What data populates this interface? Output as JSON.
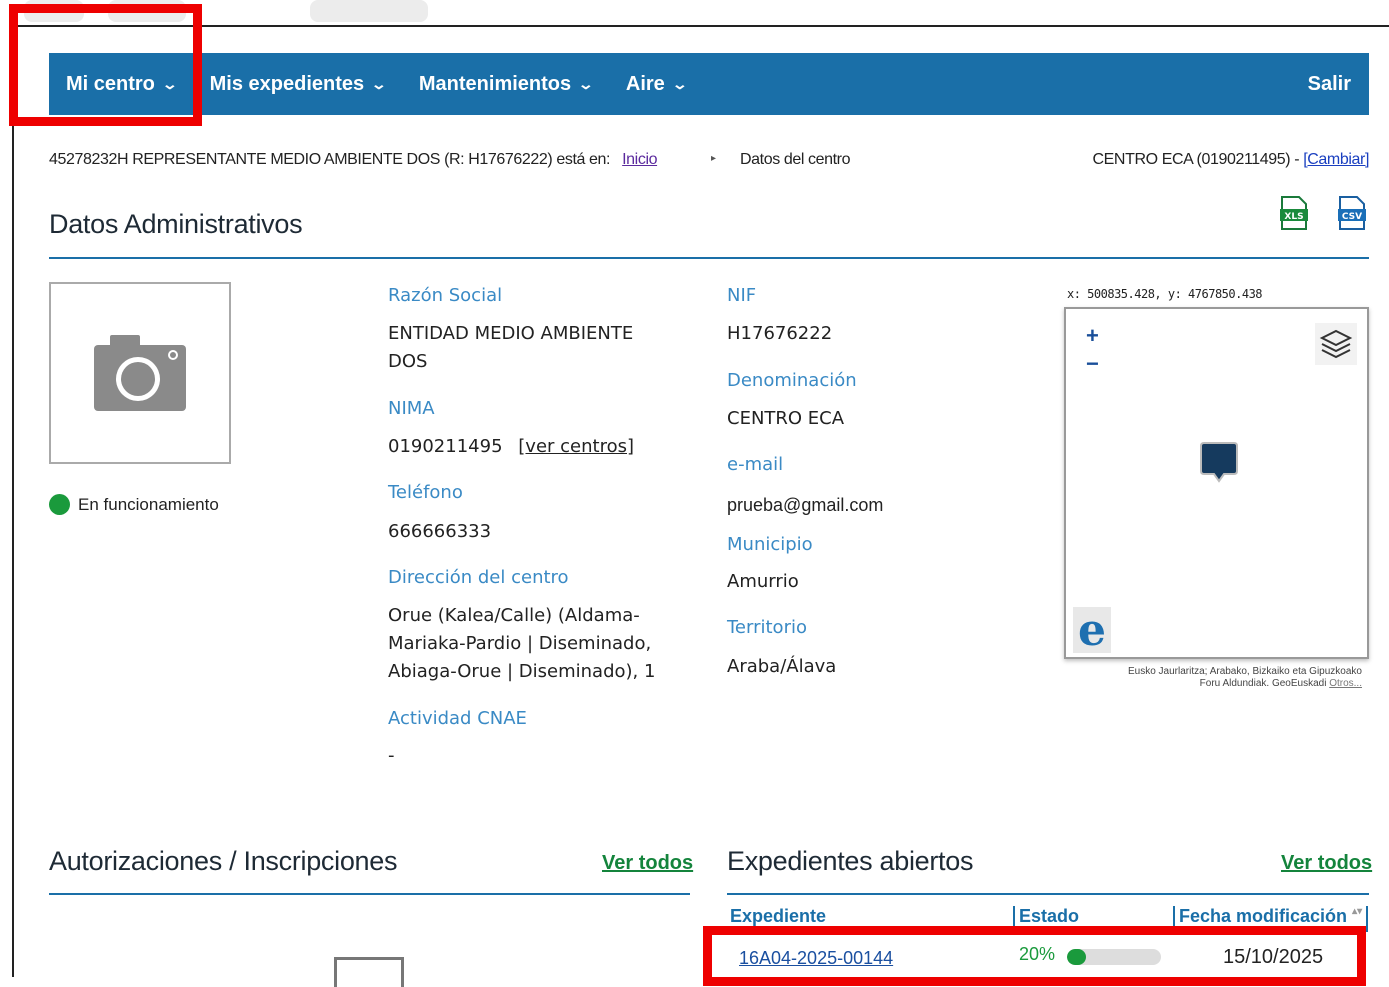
{
  "nav": {
    "items": [
      {
        "label": "Mi centro"
      },
      {
        "label": "Mis expedientes"
      },
      {
        "label": "Mantenimientos"
      },
      {
        "label": "Aire"
      }
    ],
    "exit_label": "Salir"
  },
  "breadcrumb": {
    "user": "45278232H REPRESENTANTE MEDIO AMBIENTE DOS (R: H17676222) está en:",
    "home_label": "Inicio",
    "current": "Datos del centro",
    "center_text": "CENTRO ECA (0190211495) - ",
    "change_label": "[Cambiar]"
  },
  "admin": {
    "title": "Datos Administrativos",
    "status": "En funcionamiento",
    "status_color": "#1a9a3c",
    "razon_social_label": "Razón Social",
    "razon_social_line1": "ENTIDAD MEDIO AMBIENTE",
    "razon_social_line2": "DOS",
    "nima_label": "NIMA",
    "nima_value": "0190211495",
    "ver_centros": "[ver centros]",
    "telefono_label": "Teléfono",
    "telefono_value": "666666333",
    "direccion_label": "Dirección del centro",
    "direccion_line1": "Orue (Kalea/Calle) (Aldama-",
    "direccion_line2": "Mariaka-Pardio | Diseminado,",
    "direccion_line3": "Abiaga-Orue | Diseminado), 1",
    "cnae_label": "Actividad CNAE",
    "cnae_value": "-",
    "nif_label": "NIF",
    "nif_value": "H17676222",
    "denominacion_label": "Denominación",
    "denominacion_value": "CENTRO ECA",
    "email_label": "e-mail",
    "email_value": "prueba@gmail.com",
    "municipio_label": "Municipio",
    "municipio_value": "Amurrio",
    "territorio_label": "Territorio",
    "territorio_value": "Araba/Álava"
  },
  "map": {
    "coords": "x: 500835.428, y: 4767850.438",
    "zoom_in": "+",
    "zoom_out": "−",
    "attribution_line1": "Eusko Jaurlaritza; Arabako, Bizkaiko eta Gipuzkoako",
    "attribution_line2": "Foru Aldundiak. GeoEuskadi ",
    "attribution_more": "Otros..."
  },
  "autorizaciones": {
    "title": "Autorizaciones / Inscripciones",
    "ver_todos": "Ver todos"
  },
  "expedientes": {
    "title": "Expedientes abiertos",
    "ver_todos": "Ver todos",
    "columns": [
      "Expediente",
      "Estado",
      "Fecha modificación"
    ],
    "rows": [
      {
        "expediente": "16A04-2025-00144",
        "estado_pct": "20%",
        "progress": 0.2,
        "fecha": "15/10/2025"
      }
    ]
  },
  "colors": {
    "nav_bg": "#1a6fa8",
    "label_blue": "#3a8ac5",
    "link_green": "#14843c",
    "highlight_red": "#ee0000"
  }
}
